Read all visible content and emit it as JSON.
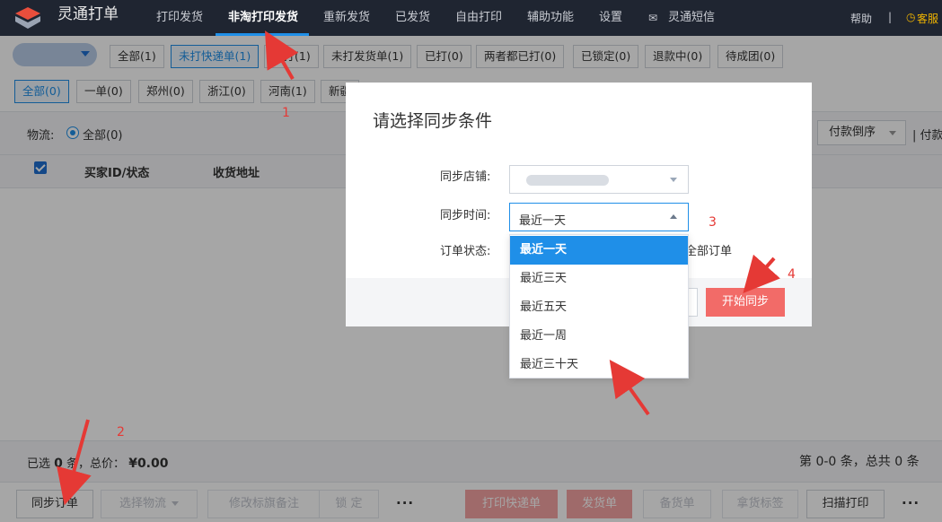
{
  "app": {
    "title": "灵通打单"
  },
  "nav": {
    "items": [
      "打印发货",
      "非淘打印发货",
      "重新发货",
      "已发货",
      "自由打印",
      "辅助功能",
      "设置",
      "灵通短信"
    ],
    "help": "帮助",
    "separator": "|",
    "customer_service": "客服"
  },
  "status_tags": [
    "全部(1)",
    "未打快递单(1)",
    "已打(1)",
    "未打发货单(1)",
    "已打(0)",
    "两者都已打(0)",
    "已锁定(0)",
    "退款中(0)",
    "待成团(0)"
  ],
  "region_tags": [
    "全部(0)",
    "一单(0)",
    "郑州(0)",
    "浙江(0)",
    "河南(1)",
    "新疆"
  ],
  "filters": {
    "logistics_label": "物流:",
    "logistics_option": "全部(0)",
    "sort_label": "付款倒序",
    "sort_extra": "| 付款"
  },
  "table": {
    "columns": [
      "买家ID/状态",
      "收货地址"
    ]
  },
  "summary": {
    "selected_prefix": "已选",
    "selected_count": "0",
    "selected_suffix": "条，总价：",
    "total": "¥0.00",
    "page_info": "第 0-0 条，总共 0 条"
  },
  "actions": {
    "sync": "同步订单",
    "select_logistics": "选择物流",
    "edit_flag": "修改标旗备注",
    "lock": "锁 定",
    "more": "···",
    "print_express": "打印快递单",
    "ship": "发货单",
    "stock": "备货单",
    "pick": "拿货标签",
    "scan_print": "扫描打印",
    "more2": "···"
  },
  "modal": {
    "title": "请选择同步条件",
    "store_label": "同步店铺:",
    "time_label": "同步时间:",
    "time_value": "最近一天",
    "status_label": "订单状态:",
    "status_text": "全部订单",
    "start_button": "开始同步"
  },
  "dropdown": {
    "options": [
      "最近一天",
      "最近三天",
      "最近五天",
      "最近一周",
      "最近三十天"
    ],
    "selected_index": 0
  },
  "annotations": [
    "1",
    "2",
    "3",
    "4"
  ],
  "colors": {
    "nav_bg": "#1f2531",
    "accent": "#1f8fe8",
    "danger": "#f26b68",
    "annotation": "#e53935"
  }
}
